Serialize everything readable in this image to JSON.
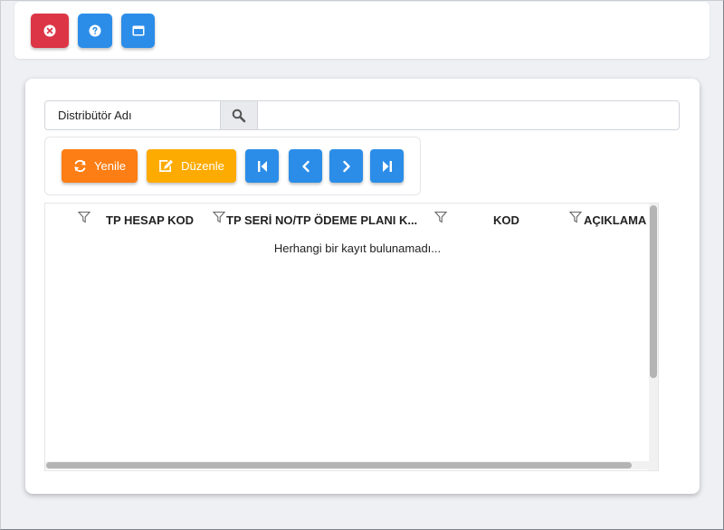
{
  "toolbar": {
    "close_icon": "close-circle-icon",
    "help_icon": "help-circle-icon",
    "window_icon": "window-icon",
    "danger_color": "#dc3545",
    "primary_color": "#2b8de8"
  },
  "search": {
    "label": "Distribütör Adı",
    "value": "",
    "icon": "search-icon"
  },
  "actions": {
    "refresh_label": "Yenile",
    "refresh_color": "#fd7e14",
    "edit_label": "Düzenle",
    "edit_color": "#fdab00",
    "nav_icons": [
      "first-page-icon",
      "previous-page-icon",
      "next-page-icon",
      "last-page-icon"
    ]
  },
  "grid": {
    "columns": [
      {
        "label": "TP HESAP KOD"
      },
      {
        "label": "TP SERİ NO/TP ÖDEME PLANI K..."
      },
      {
        "label": "KOD"
      },
      {
        "label": "AÇIKLAMA"
      }
    ],
    "empty_message": "Herhangi bir kayıt bulunamadı..."
  }
}
